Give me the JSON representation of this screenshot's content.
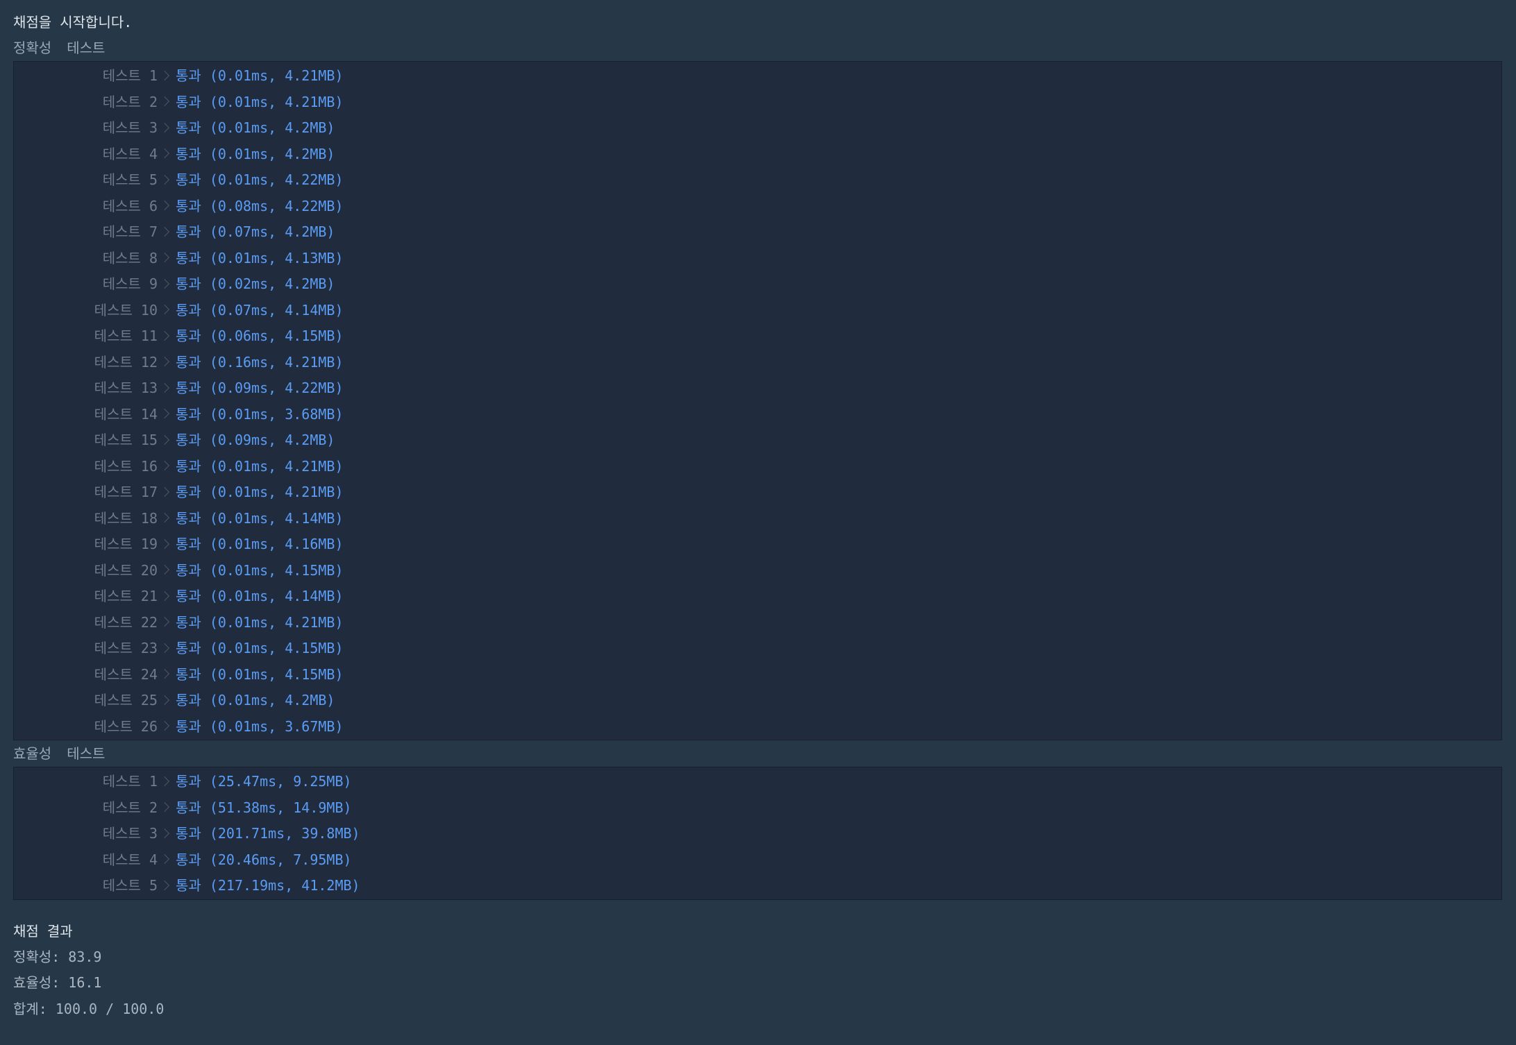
{
  "start_message": "채점을 시작합니다.",
  "accuracy": {
    "header_a": "정확성",
    "header_b": "테스트",
    "rows": [
      {
        "label": "테스트 1",
        "result": "통과 (0.01ms, 4.21MB)"
      },
      {
        "label": "테스트 2",
        "result": "통과 (0.01ms, 4.21MB)"
      },
      {
        "label": "테스트 3",
        "result": "통과 (0.01ms, 4.2MB)"
      },
      {
        "label": "테스트 4",
        "result": "통과 (0.01ms, 4.2MB)"
      },
      {
        "label": "테스트 5",
        "result": "통과 (0.01ms, 4.22MB)"
      },
      {
        "label": "테스트 6",
        "result": "통과 (0.08ms, 4.22MB)"
      },
      {
        "label": "테스트 7",
        "result": "통과 (0.07ms, 4.2MB)"
      },
      {
        "label": "테스트 8",
        "result": "통과 (0.01ms, 4.13MB)"
      },
      {
        "label": "테스트 9",
        "result": "통과 (0.02ms, 4.2MB)"
      },
      {
        "label": "테스트 10",
        "result": "통과 (0.07ms, 4.14MB)"
      },
      {
        "label": "테스트 11",
        "result": "통과 (0.06ms, 4.15MB)"
      },
      {
        "label": "테스트 12",
        "result": "통과 (0.16ms, 4.21MB)"
      },
      {
        "label": "테스트 13",
        "result": "통과 (0.09ms, 4.22MB)"
      },
      {
        "label": "테스트 14",
        "result": "통과 (0.01ms, 3.68MB)"
      },
      {
        "label": "테스트 15",
        "result": "통과 (0.09ms, 4.2MB)"
      },
      {
        "label": "테스트 16",
        "result": "통과 (0.01ms, 4.21MB)"
      },
      {
        "label": "테스트 17",
        "result": "통과 (0.01ms, 4.21MB)"
      },
      {
        "label": "테스트 18",
        "result": "통과 (0.01ms, 4.14MB)"
      },
      {
        "label": "테스트 19",
        "result": "통과 (0.01ms, 4.16MB)"
      },
      {
        "label": "테스트 20",
        "result": "통과 (0.01ms, 4.15MB)"
      },
      {
        "label": "테스트 21",
        "result": "통과 (0.01ms, 4.14MB)"
      },
      {
        "label": "테스트 22",
        "result": "통과 (0.01ms, 4.21MB)"
      },
      {
        "label": "테스트 23",
        "result": "통과 (0.01ms, 4.15MB)"
      },
      {
        "label": "테스트 24",
        "result": "통과 (0.01ms, 4.15MB)"
      },
      {
        "label": "테스트 25",
        "result": "통과 (0.01ms, 4.2MB)"
      },
      {
        "label": "테스트 26",
        "result": "통과 (0.01ms, 3.67MB)"
      }
    ]
  },
  "efficiency": {
    "header_a": "효율성",
    "header_b": "테스트",
    "rows": [
      {
        "label": "테스트 1",
        "result": "통과 (25.47ms, 9.25MB)"
      },
      {
        "label": "테스트 2",
        "result": "통과 (51.38ms, 14.9MB)"
      },
      {
        "label": "테스트 3",
        "result": "통과 (201.71ms, 39.8MB)"
      },
      {
        "label": "테스트 4",
        "result": "통과 (20.46ms, 7.95MB)"
      },
      {
        "label": "테스트 5",
        "result": "통과 (217.19ms, 41.2MB)"
      }
    ]
  },
  "summary": {
    "title": "채점 결과",
    "accuracy_line": "정확성: 83.9",
    "efficiency_line": "효율성: 16.1",
    "total_line": "합계: 100.0 / 100.0"
  },
  "colors": {
    "background": "#263747",
    "panel": "#202b3d",
    "pass": "#5b9cf4",
    "label": "#6f7d8b"
  },
  "icons": {
    "row_separator": "chevron-right-icon"
  }
}
